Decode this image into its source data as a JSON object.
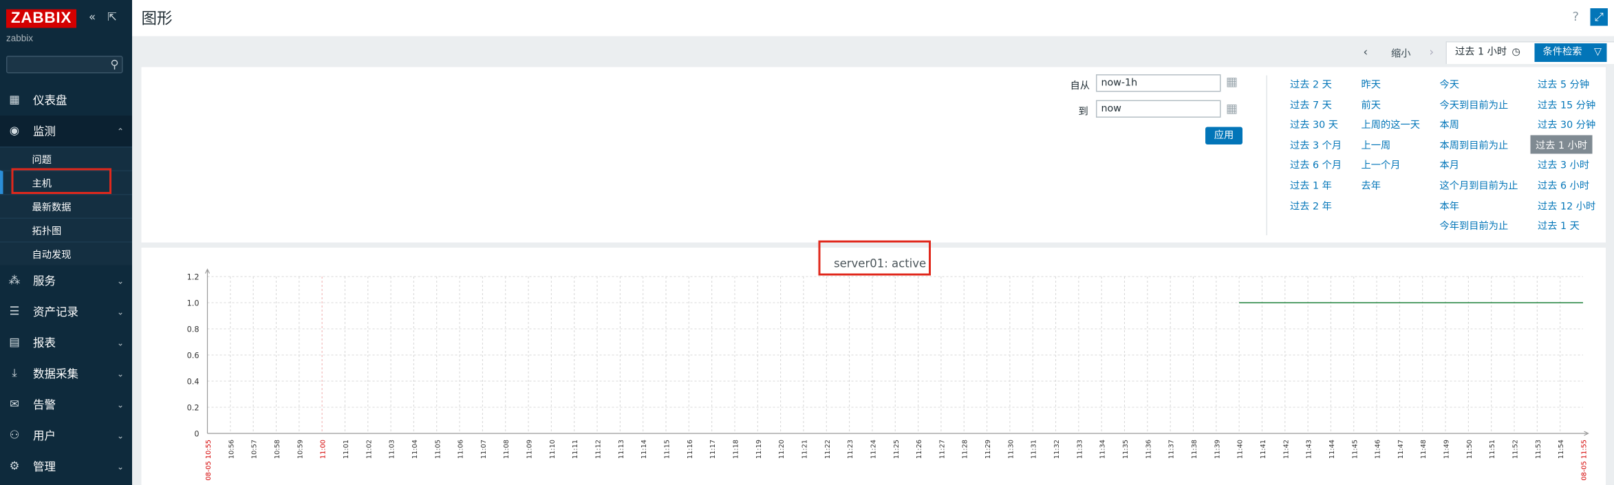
{
  "sidebar": {
    "logo": "ZABBIX",
    "collapse_icon": "collapse-icon",
    "kiosk_icon": "kiosk-icon",
    "server_name": "zabbix",
    "search": {
      "value": "",
      "placeholder": ""
    },
    "menu": [
      {
        "label": "仪表盘",
        "icon": "dashboard-icon"
      },
      {
        "label": "监测",
        "icon": "eye-icon",
        "open": true,
        "children": [
          "问题",
          "主机",
          "最新数据",
          "拓扑图",
          "自动发现"
        ]
      },
      {
        "label": "服务",
        "icon": "services-icon"
      },
      {
        "label": "资产记录",
        "icon": "list-icon"
      },
      {
        "label": "报表",
        "icon": "report-icon"
      },
      {
        "label": "数据采集",
        "icon": "download-icon"
      },
      {
        "label": "告警",
        "icon": "mail-icon"
      },
      {
        "label": "用户",
        "icon": "users-icon"
      },
      {
        "label": "管理",
        "icon": "gear-icon"
      }
    ]
  },
  "header": {
    "title": "图形"
  },
  "filterbar": {
    "zoom_out": "缩小",
    "active_tab": "过去 1 小时",
    "filter_button": "条件检索"
  },
  "timefilter": {
    "from_label": "自从",
    "from_value": "now-1h",
    "to_label": "到",
    "to_value": "now",
    "apply": "应用",
    "quick_ranges": [
      [
        "过去 2 天",
        "过去 7 天",
        "过去 30 天",
        "过去 3 个月",
        "过去 6 个月",
        "过去 1 年",
        "过去 2 年"
      ],
      [
        "昨天",
        "前天",
        "上周的这一天",
        "上一周",
        "上一个月",
        "去年"
      ],
      [
        "今天",
        "今天到目前为止",
        "本周",
        "本周到目前为止",
        "本月",
        "这个月到目前为止",
        "本年",
        "今年到目前为止"
      ],
      [
        "过去 5 分钟",
        "过去 15 分钟",
        "过去 30 分钟",
        "过去 1 小时",
        "过去 3 小时",
        "过去 6 小时",
        "过去 12 小时",
        "过去 1 天"
      ]
    ],
    "selected": "过去 1 小时"
  },
  "colors": {
    "accent": "#0275b8",
    "sidebar": "#0e2a3c",
    "series": "#1a7f37",
    "highlight": "#e0281c"
  },
  "chart_data": {
    "type": "line",
    "title": "server01: active",
    "ylim": [
      0,
      1.2
    ],
    "y_ticks": [
      "0",
      "0.2",
      "0.4",
      "0.6",
      "0.8",
      "1.0",
      "1.2"
    ],
    "x_start_label": "08-05 10:55",
    "x_end_label": "08-05 11:55",
    "x_ticks": [
      "10:56",
      "10:57",
      "10:58",
      "10:59",
      "11:00",
      "11:01",
      "11:02",
      "11:03",
      "11:04",
      "11:05",
      "11:06",
      "11:07",
      "11:08",
      "11:09",
      "11:10",
      "11:11",
      "11:12",
      "11:13",
      "11:14",
      "11:15",
      "11:16",
      "11:17",
      "11:18",
      "11:19",
      "11:20",
      "11:21",
      "11:22",
      "11:23",
      "11:24",
      "11:25",
      "11:26",
      "11:27",
      "11:28",
      "11:29",
      "11:30",
      "11:31",
      "11:32",
      "11:33",
      "11:34",
      "11:35",
      "11:36",
      "11:37",
      "11:38",
      "11:39",
      "11:40",
      "11:41",
      "11:42",
      "11:43",
      "11:44",
      "11:45",
      "11:46",
      "11:47",
      "11:48",
      "11:49",
      "11:50",
      "11:51",
      "11:52",
      "11:53",
      "11:54"
    ],
    "highlight_ticks": [
      "11:00"
    ],
    "series": [
      {
        "points": [
          [
            "11:40",
            1.0
          ],
          [
            "11:55",
            1.0
          ]
        ]
      }
    ],
    "grid": true
  }
}
